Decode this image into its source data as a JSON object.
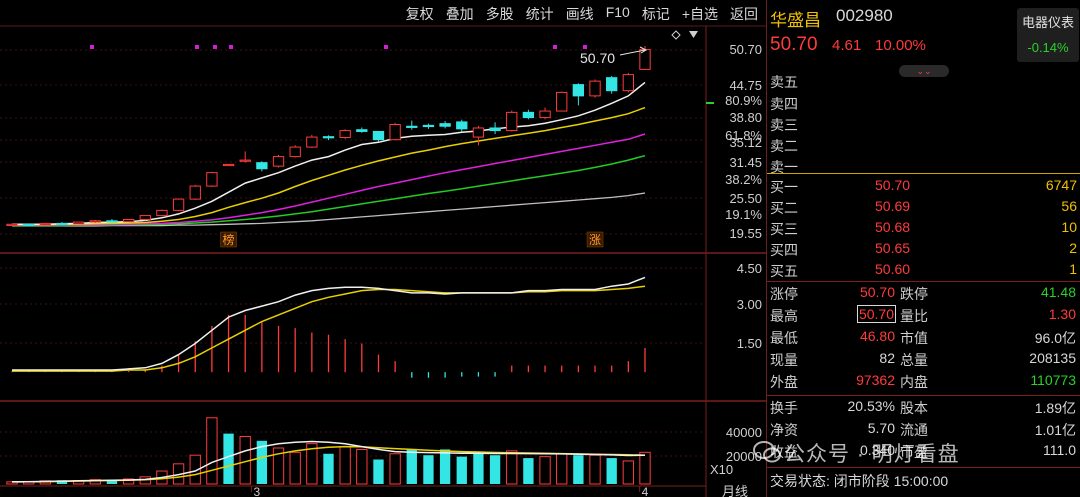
{
  "toolbar": [
    {
      "key": "fuquan",
      "label": "复权"
    },
    {
      "key": "diejia",
      "label": "叠加"
    },
    {
      "key": "duogu",
      "label": "多股"
    },
    {
      "key": "tongji",
      "label": "统计"
    },
    {
      "key": "huaxian",
      "label": "画线"
    },
    {
      "key": "f10",
      "label": "F10"
    },
    {
      "key": "biaoji",
      "label": "标记"
    },
    {
      "key": "zixuan",
      "label": "+自选"
    },
    {
      "key": "fanhui",
      "label": "返回"
    }
  ],
  "stock": {
    "name": "华盛昌",
    "code": "002980",
    "price": "50.70",
    "change": "4.61",
    "change_pct": "10.00%",
    "sector_name": "电器仪表",
    "sector_change": "-0.14%"
  },
  "orderbook": {
    "sell": [
      {
        "label": "卖五"
      },
      {
        "label": "卖四"
      },
      {
        "label": "卖三"
      },
      {
        "label": "卖二"
      },
      {
        "label": "卖一"
      }
    ],
    "buy": [
      {
        "label": "买一",
        "price": "50.70",
        "volume": "6747"
      },
      {
        "label": "买二",
        "price": "50.69",
        "volume": "56"
      },
      {
        "label": "买三",
        "price": "50.68",
        "volume": "10"
      },
      {
        "label": "买四",
        "price": "50.65",
        "volume": "2"
      },
      {
        "label": "买五",
        "price": "50.60",
        "volume": "1"
      }
    ]
  },
  "stats": {
    "zhangting_l": "涨停",
    "zhangting_v": "50.70",
    "dieting_l": "跌停",
    "dieting_v": "41.48",
    "zuigao_l": "最高",
    "zuigao_v": "50.70",
    "liangbi_l": "量比",
    "liangbi_v": "1.30",
    "zuidi_l": "最低",
    "zuidi_v": "46.80",
    "shizhi_l": "市值",
    "shizhi_v": "96.0亿",
    "xianliang_l": "现量",
    "xianliang_v": "82",
    "zongliang_l": "总量",
    "zongliang_v": "208135",
    "waipan_l": "外盘",
    "waipan_v": "97362",
    "neipan_l": "内盘",
    "neipan_v": "110773",
    "huanshou_l": "换手",
    "huanshou_v": "20.53%",
    "guben_l": "股本",
    "guben_v": "1.89亿",
    "jingzi_l": "净资",
    "jingzi_v": "5.70",
    "liutong_l": "流通",
    "liutong_v": "1.01亿",
    "shouyi_l": "收益",
    "shouyi_v": "0.340",
    "shiying_l": "市盈",
    "shiying_v": "111.0"
  },
  "status_text": "交易状态: 闭市阶段 15:00:00",
  "watermark": "公众号 · 明灯看盘",
  "chart_data": {
    "type": "candlestick",
    "price_axis_ticks": [
      "50.70",
      "44.75",
      "38.80",
      "35.12",
      "31.45",
      "25.50",
      "19.55"
    ],
    "percent_axis_ticks": [
      "80.9%",
      "61.8%",
      "38.2%",
      "19.1%"
    ],
    "indicator_ticks": [
      "4.50",
      "3.00",
      "1.50"
    ],
    "volume_ticks": [
      "40000",
      "20000"
    ],
    "volume_unit": "X10",
    "x_labels": [
      "3",
      "4"
    ],
    "period_label": "月线",
    "last_price_label": "50.70",
    "markers": [
      {
        "text": "榜",
        "index": 13
      },
      {
        "text": "涨",
        "index": 35
      }
    ],
    "price_range": [
      19.55,
      50.7
    ],
    "candles": [
      [
        10.2,
        10.5,
        10.1,
        10.4
      ],
      [
        10.4,
        10.6,
        10.2,
        10.3
      ],
      [
        10.3,
        10.7,
        10.2,
        10.6
      ],
      [
        10.6,
        10.9,
        10.4,
        10.5
      ],
      [
        10.5,
        11.0,
        10.4,
        10.9
      ],
      [
        10.9,
        11.4,
        10.7,
        11.2
      ],
      [
        11.2,
        11.6,
        10.9,
        11.0
      ],
      [
        11.0,
        11.6,
        10.9,
        11.5
      ],
      [
        11.5,
        12.5,
        11.3,
        12.4
      ],
      [
        12.4,
        13.8,
        12.2,
        13.6
      ],
      [
        13.6,
        16.4,
        13.4,
        16.2
      ],
      [
        16.2,
        19.5,
        16.0,
        19.2
      ],
      [
        19.2,
        22.5,
        19.0,
        22.3
      ],
      [
        24.1,
        24.3,
        24.0,
        24.2
      ],
      [
        25.0,
        27.2,
        24.6,
        25.2
      ],
      [
        24.6,
        24.9,
        22.6,
        23.2
      ],
      [
        23.8,
        26.4,
        23.5,
        26.0
      ],
      [
        26.0,
        28.6,
        25.8,
        28.2
      ],
      [
        28.2,
        31.0,
        28.0,
        30.5
      ],
      [
        30.6,
        30.9,
        29.8,
        30.4
      ],
      [
        30.4,
        32.3,
        30.1,
        32.0
      ],
      [
        32.2,
        32.7,
        31.5,
        31.8
      ],
      [
        31.8,
        31.9,
        29.5,
        29.9
      ],
      [
        29.9,
        33.8,
        29.8,
        33.4
      ],
      [
        33.0,
        34.3,
        32.2,
        32.9
      ],
      [
        33.2,
        33.6,
        32.4,
        33.0
      ],
      [
        33.6,
        34.2,
        32.5,
        33.0
      ],
      [
        34.0,
        34.5,
        31.8,
        32.4
      ],
      [
        30.5,
        33.1,
        28.6,
        32.6
      ],
      [
        32.6,
        33.9,
        31.2,
        32.0
      ],
      [
        32.0,
        36.6,
        31.8,
        36.2
      ],
      [
        36.2,
        36.8,
        34.6,
        35.0
      ],
      [
        35.0,
        37.3,
        34.6,
        36.5
      ],
      [
        36.5,
        41.0,
        36.4,
        40.8
      ],
      [
        42.6,
        42.9,
        37.8,
        40.0
      ],
      [
        40.0,
        43.8,
        39.6,
        43.4
      ],
      [
        44.2,
        44.6,
        40.5,
        41.2
      ],
      [
        41.2,
        45.3,
        40.8,
        44.9
      ],
      [
        46.1,
        51.5,
        46.0,
        50.7
      ]
    ],
    "ma_white": [
      10.4,
      10.4,
      10.4,
      10.5,
      10.6,
      10.8,
      10.9,
      11.0,
      11.3,
      11.9,
      12.8,
      14.1,
      15.7,
      17.8,
      19.9,
      21.1,
      22.3,
      23.8,
      25.2,
      26.0,
      27.5,
      28.8,
      29.3,
      30.2,
      30.7,
      30.9,
      31.1,
      31.6,
      31.9,
      32.4,
      32.8,
      33.1,
      33.7,
      34.5,
      35.4,
      36.7,
      38.3,
      40.0,
      43.1
    ],
    "ma_yellow": [
      10.3,
      10.3,
      10.3,
      10.4,
      10.4,
      10.5,
      10.6,
      10.7,
      10.8,
      11.1,
      11.5,
      12.2,
      13.1,
      14.3,
      15.4,
      16.4,
      17.6,
      19.1,
      20.5,
      21.7,
      22.9,
      24.0,
      25.0,
      25.9,
      26.8,
      27.5,
      28.3,
      29.0,
      29.6,
      30.2,
      30.8,
      31.4,
      32.0,
      32.7,
      33.4,
      34.2,
      35.0,
      35.9,
      37.3
    ],
    "ma_magenta": [
      10.2,
      10.2,
      10.2,
      10.3,
      10.3,
      10.3,
      10.4,
      10.4,
      10.5,
      10.6,
      10.8,
      11.1,
      11.4,
      11.9,
      12.5,
      13.1,
      13.8,
      14.6,
      15.5,
      16.4,
      17.3,
      18.2,
      19.1,
      19.9,
      20.7,
      21.5,
      22.3,
      23.0,
      23.7,
      24.4,
      25.1,
      25.8,
      26.5,
      27.2,
      27.9,
      28.6,
      29.3,
      30.0,
      31.2
    ],
    "ma_green": [
      10.1,
      10.1,
      10.1,
      10.1,
      10.2,
      10.2,
      10.2,
      10.3,
      10.3,
      10.4,
      10.5,
      10.7,
      10.9,
      11.2,
      11.5,
      11.9,
      12.3,
      12.8,
      13.3,
      13.9,
      14.5,
      15.1,
      15.7,
      16.3,
      16.9,
      17.5,
      18.0,
      18.6,
      19.2,
      19.8,
      20.4,
      21.0,
      21.6,
      22.2,
      22.8,
      23.5,
      24.3,
      25.2,
      26.2
    ],
    "ma_gray": [
      10.0,
      10.0,
      10.0,
      10.0,
      10.0,
      10.0,
      10.1,
      10.1,
      10.1,
      10.1,
      10.2,
      10.2,
      10.3,
      10.4,
      10.5,
      10.6,
      10.8,
      11.0,
      11.2,
      11.5,
      11.8,
      12.1,
      12.4,
      12.7,
      13.0,
      13.3,
      13.6,
      13.9,
      14.2,
      14.5,
      14.8,
      15.1,
      15.4,
      15.7,
      16.0,
      16.3,
      16.6,
      17.0,
      17.6
    ],
    "indicator_range": [
      0,
      5.0
    ],
    "indicator_bars": [
      0.05,
      0.05,
      0.05,
      0.05,
      0.05,
      0.05,
      0.05,
      0.05,
      0.1,
      0.3,
      0.8,
      1.4,
      2.1,
      2.6,
      2.6,
      2.3,
      2.1,
      2.0,
      1.8,
      1.7,
      1.5,
      1.3,
      0.8,
      0.5,
      -0.25,
      -0.25,
      -0.25,
      -0.2,
      -0.2,
      -0.2,
      0.3,
      0.3,
      0.3,
      0.3,
      0.3,
      0.3,
      0.3,
      0.5,
      1.1
    ],
    "indicator_white": [
      0.1,
      0.1,
      0.1,
      0.1,
      0.1,
      0.1,
      0.1,
      0.15,
      0.2,
      0.4,
      0.8,
      1.3,
      1.9,
      2.5,
      2.8,
      3.0,
      3.2,
      3.5,
      3.7,
      3.8,
      3.85,
      3.85,
      3.8,
      3.7,
      3.6,
      3.6,
      3.55,
      3.6,
      3.6,
      3.6,
      3.6,
      3.7,
      3.7,
      3.75,
      3.75,
      3.75,
      3.9,
      4.0,
      4.3
    ],
    "indicator_yellow": [
      0.05,
      0.05,
      0.05,
      0.05,
      0.05,
      0.05,
      0.05,
      0.1,
      0.1,
      0.2,
      0.4,
      0.7,
      1.1,
      1.5,
      1.9,
      2.3,
      2.6,
      2.9,
      3.2,
      3.4,
      3.55,
      3.7,
      3.75,
      3.75,
      3.7,
      3.65,
      3.6,
      3.6,
      3.6,
      3.6,
      3.6,
      3.65,
      3.65,
      3.7,
      3.7,
      3.7,
      3.75,
      3.8,
      3.9
    ],
    "volume_range": [
      0,
      50000
    ],
    "volume": [
      [
        1500,
        "u"
      ],
      [
        1800,
        "u"
      ],
      [
        2200,
        "u"
      ],
      [
        2600,
        "d"
      ],
      [
        2400,
        "u"
      ],
      [
        3000,
        "u"
      ],
      [
        2800,
        "d"
      ],
      [
        3500,
        "u"
      ],
      [
        5000,
        "u"
      ],
      [
        9000,
        "u"
      ],
      [
        14000,
        "u"
      ],
      [
        20000,
        "u"
      ],
      [
        46000,
        "u"
      ],
      [
        35000,
        "d"
      ],
      [
        33000,
        "u"
      ],
      [
        30000,
        "d"
      ],
      [
        25000,
        "u"
      ],
      [
        22000,
        "u"
      ],
      [
        28000,
        "u"
      ],
      [
        21000,
        "d"
      ],
      [
        26000,
        "u"
      ],
      [
        24000,
        "u"
      ],
      [
        17000,
        "d"
      ],
      [
        21000,
        "u"
      ],
      [
        24000,
        "d"
      ],
      [
        20000,
        "d"
      ],
      [
        24000,
        "d"
      ],
      [
        19000,
        "d"
      ],
      [
        22000,
        "d"
      ],
      [
        20000,
        "d"
      ],
      [
        23000,
        "u"
      ],
      [
        18000,
        "d"
      ],
      [
        19000,
        "u"
      ],
      [
        21000,
        "u"
      ],
      [
        20000,
        "d"
      ],
      [
        20000,
        "u"
      ],
      [
        18000,
        "d"
      ],
      [
        16000,
        "u"
      ],
      [
        22000,
        "u"
      ]
    ],
    "volume_white": [
      1500,
      1600,
      1800,
      2000,
      2200,
      2400,
      2600,
      2800,
      3200,
      4500,
      6500,
      9000,
      15000,
      19000,
      23000,
      26000,
      28000,
      29000,
      29500,
      29000,
      28000,
      26000,
      24000,
      22500,
      22000,
      21800,
      21600,
      21400,
      21300,
      21200,
      21200,
      21100,
      21000,
      20900,
      20700,
      20500,
      20200,
      19800,
      20000
    ],
    "volume_yellow": [
      1400,
      1500,
      1600,
      1800,
      2000,
      2200,
      2400,
      2600,
      2900,
      3600,
      4800,
      6500,
      9500,
      12500,
      15500,
      18500,
      21000,
      23000,
      24500,
      25500,
      26000,
      25800,
      25200,
      24600,
      24000,
      23400,
      22900,
      22500,
      22200,
      21900,
      21700,
      21500,
      21300,
      21100,
      20900,
      20700,
      20500,
      20300,
      20100
    ]
  }
}
